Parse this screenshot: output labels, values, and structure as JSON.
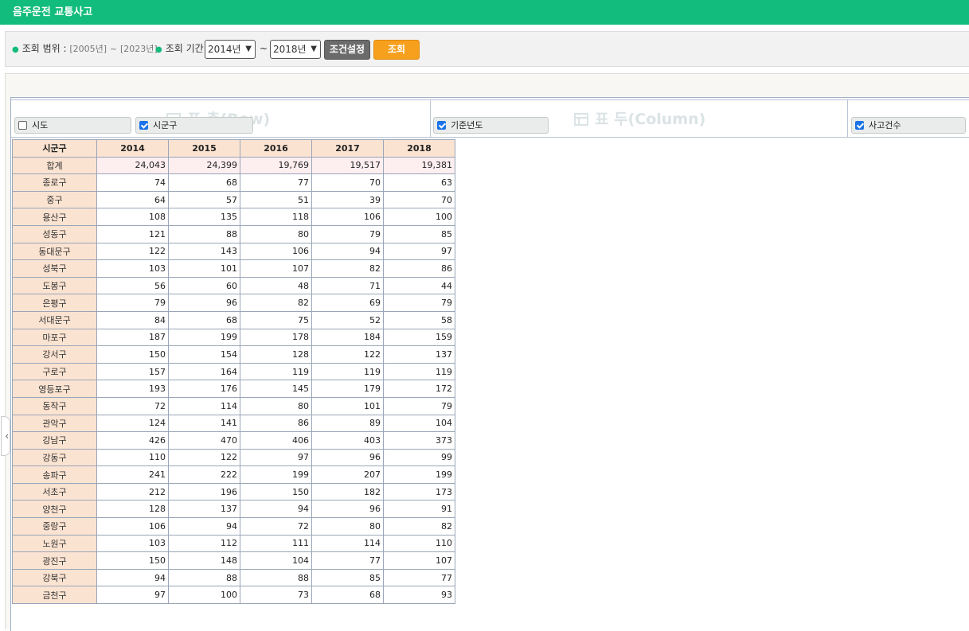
{
  "title": "음주운전 교통사고",
  "search": {
    "range_label": "조회 범위",
    "range_start": "[2005년]",
    "range_end": "[2023년]",
    "period_label": "조회 기간",
    "from_year": "2014년",
    "to_year": "2018년",
    "condition_button": "조건설정",
    "search_button": "조회"
  },
  "pivot": {
    "row_zone_watermark": "표 측(Row)",
    "column_zone_watermark": "표 두(Column)",
    "fields": [
      {
        "label": "시도",
        "checked": false
      },
      {
        "label": "시군구",
        "checked": true
      },
      {
        "label": "기준년도",
        "checked": true
      },
      {
        "label": "사고건수",
        "checked": true
      }
    ]
  },
  "table": {
    "row_header": "시군구",
    "years": [
      "2014",
      "2015",
      "2016",
      "2017",
      "2018"
    ],
    "rows": [
      {
        "name": "합계",
        "values": [
          "24,043",
          "24,399",
          "19,769",
          "19,517",
          "19,381"
        ]
      },
      {
        "name": "종로구",
        "values": [
          "74",
          "68",
          "77",
          "70",
          "63"
        ]
      },
      {
        "name": "중구",
        "values": [
          "64",
          "57",
          "51",
          "39",
          "70"
        ]
      },
      {
        "name": "용산구",
        "values": [
          "108",
          "135",
          "118",
          "106",
          "100"
        ]
      },
      {
        "name": "성동구",
        "values": [
          "121",
          "88",
          "80",
          "79",
          "85"
        ]
      },
      {
        "name": "동대문구",
        "values": [
          "122",
          "143",
          "106",
          "94",
          "97"
        ]
      },
      {
        "name": "성북구",
        "values": [
          "103",
          "101",
          "107",
          "82",
          "86"
        ]
      },
      {
        "name": "도봉구",
        "values": [
          "56",
          "60",
          "48",
          "71",
          "44"
        ]
      },
      {
        "name": "은평구",
        "values": [
          "79",
          "96",
          "82",
          "69",
          "79"
        ]
      },
      {
        "name": "서대문구",
        "values": [
          "84",
          "68",
          "75",
          "52",
          "58"
        ]
      },
      {
        "name": "마포구",
        "values": [
          "187",
          "199",
          "178",
          "184",
          "159"
        ]
      },
      {
        "name": "강서구",
        "values": [
          "150",
          "154",
          "128",
          "122",
          "137"
        ]
      },
      {
        "name": "구로구",
        "values": [
          "157",
          "164",
          "119",
          "119",
          "119"
        ]
      },
      {
        "name": "영등포구",
        "values": [
          "193",
          "176",
          "145",
          "179",
          "172"
        ]
      },
      {
        "name": "동작구",
        "values": [
          "72",
          "114",
          "80",
          "101",
          "79"
        ]
      },
      {
        "name": "관악구",
        "values": [
          "124",
          "141",
          "86",
          "89",
          "104"
        ]
      },
      {
        "name": "강남구",
        "values": [
          "426",
          "470",
          "406",
          "403",
          "373"
        ]
      },
      {
        "name": "강동구",
        "values": [
          "110",
          "122",
          "97",
          "96",
          "99"
        ]
      },
      {
        "name": "송파구",
        "values": [
          "241",
          "222",
          "199",
          "207",
          "199"
        ]
      },
      {
        "name": "서초구",
        "values": [
          "212",
          "196",
          "150",
          "182",
          "173"
        ]
      },
      {
        "name": "양천구",
        "values": [
          "128",
          "137",
          "94",
          "96",
          "91"
        ]
      },
      {
        "name": "중랑구",
        "values": [
          "106",
          "94",
          "72",
          "80",
          "82"
        ]
      },
      {
        "name": "노원구",
        "values": [
          "103",
          "112",
          "111",
          "114",
          "110"
        ]
      },
      {
        "name": "광진구",
        "values": [
          "150",
          "148",
          "104",
          "77",
          "107"
        ]
      },
      {
        "name": "강북구",
        "values": [
          "94",
          "88",
          "88",
          "85",
          "77"
        ]
      },
      {
        "name": "금천구",
        "values": [
          "97",
          "100",
          "73",
          "68",
          "93"
        ]
      }
    ]
  }
}
